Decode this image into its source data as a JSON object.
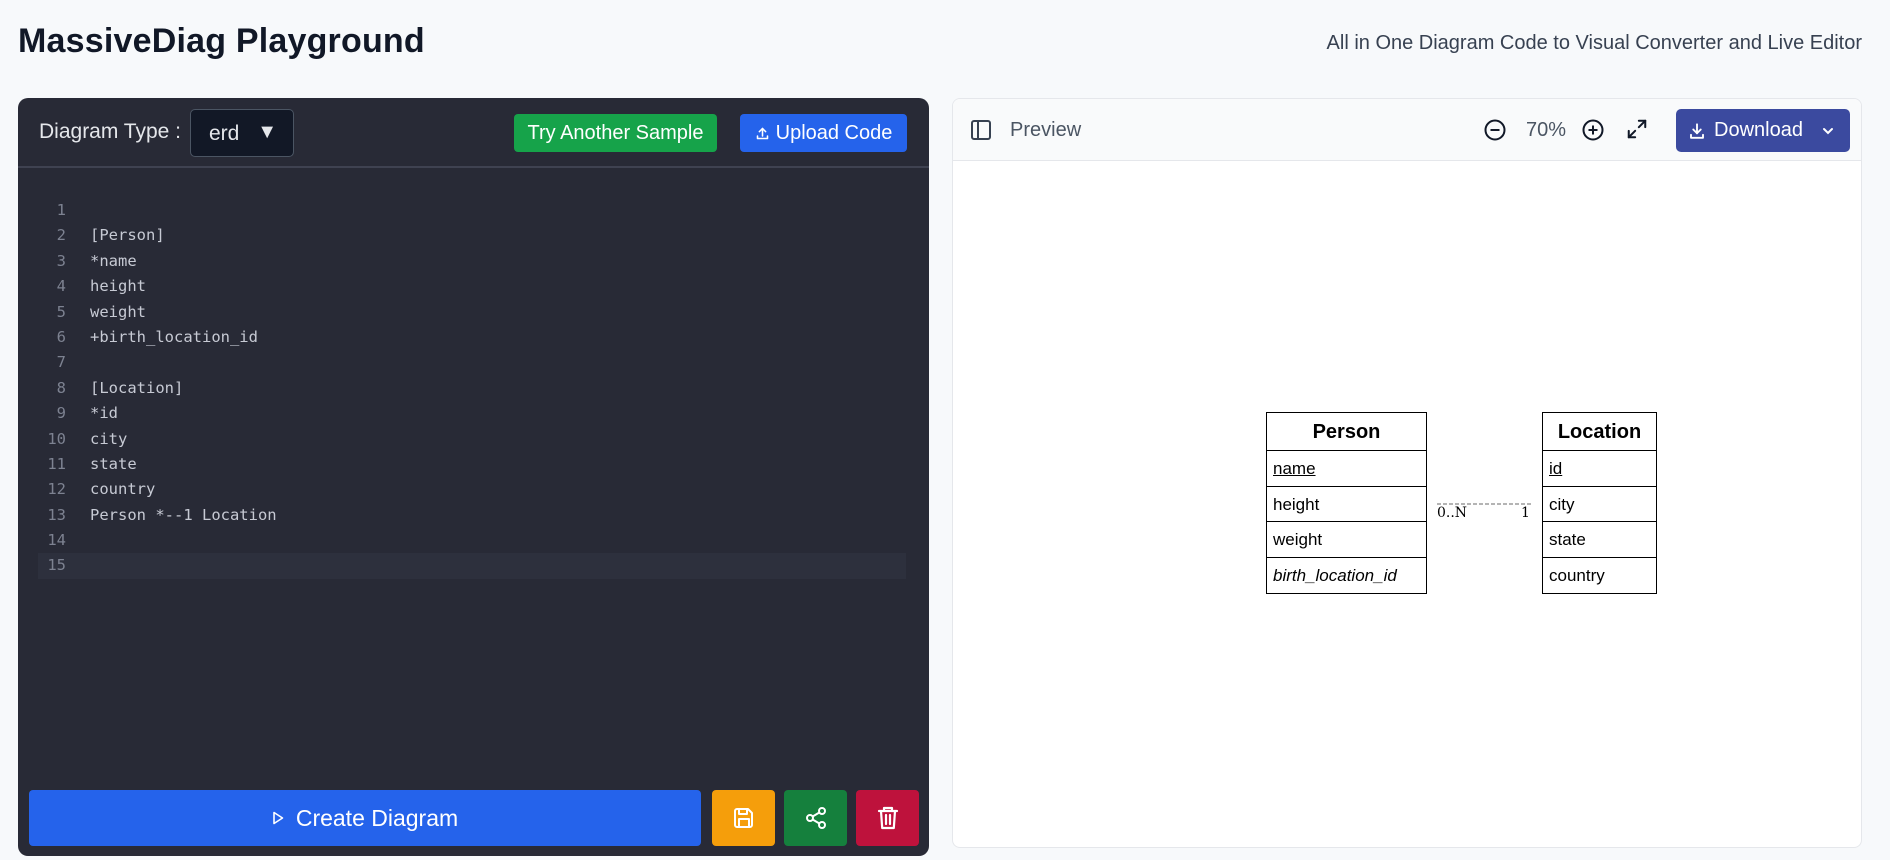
{
  "app": {
    "title": "MassiveDiag Playground",
    "subtitle": "All in One Diagram Code to Visual Converter and Live Editor"
  },
  "editor": {
    "diagram_type_label": "Diagram Type :",
    "diagram_type_value": "erd",
    "try_sample_label": "Try Another Sample",
    "upload_label": "Upload Code",
    "lines": [
      {
        "n": "1",
        "t": ""
      },
      {
        "n": "2",
        "t": "[Person]"
      },
      {
        "n": "3",
        "t": "*name"
      },
      {
        "n": "4",
        "t": "height"
      },
      {
        "n": "5",
        "t": "weight"
      },
      {
        "n": "6",
        "t": "+birth_location_id"
      },
      {
        "n": "7",
        "t": ""
      },
      {
        "n": "8",
        "t": "[Location]"
      },
      {
        "n": "9",
        "t": "*id"
      },
      {
        "n": "10",
        "t": "city"
      },
      {
        "n": "11",
        "t": "state"
      },
      {
        "n": "12",
        "t": "country"
      },
      {
        "n": "13",
        "t": "Person *--1 Location"
      },
      {
        "n": "14",
        "t": ""
      },
      {
        "n": "15",
        "t": ""
      }
    ],
    "active_line": 15,
    "create_label": "Create Diagram"
  },
  "preview": {
    "label": "Preview",
    "zoom": "70%",
    "download_label": "Download",
    "diagram": {
      "person": {
        "name": "Person",
        "fields": [
          {
            "text": "name",
            "kind": "pk"
          },
          {
            "text": "height",
            "kind": "plain"
          },
          {
            "text": "weight",
            "kind": "plain"
          },
          {
            "text": "birth_location_id",
            "kind": "fk"
          }
        ]
      },
      "location": {
        "name": "Location",
        "fields": [
          {
            "text": "id",
            "kind": "pk"
          },
          {
            "text": "city",
            "kind": "plain"
          },
          {
            "text": "state",
            "kind": "plain"
          },
          {
            "text": "country",
            "kind": "plain"
          }
        ]
      },
      "relation": {
        "left_card": "0..N",
        "right_card": "1"
      }
    }
  },
  "colors": {
    "editor_bg": "#282a36",
    "create": "#2563eb",
    "sample": "#16a34a",
    "save": "#f59e0b",
    "share": "#15803d",
    "delete": "#be123c",
    "download": "#3b4a9f"
  },
  "icons": [
    "upload-icon",
    "play-icon",
    "save-icon",
    "share-icon",
    "trash-icon",
    "sidebar-toggle-icon",
    "zoom-out-icon",
    "zoom-in-icon",
    "fullscreen-icon",
    "download-icon",
    "chevron-down-icon"
  ]
}
